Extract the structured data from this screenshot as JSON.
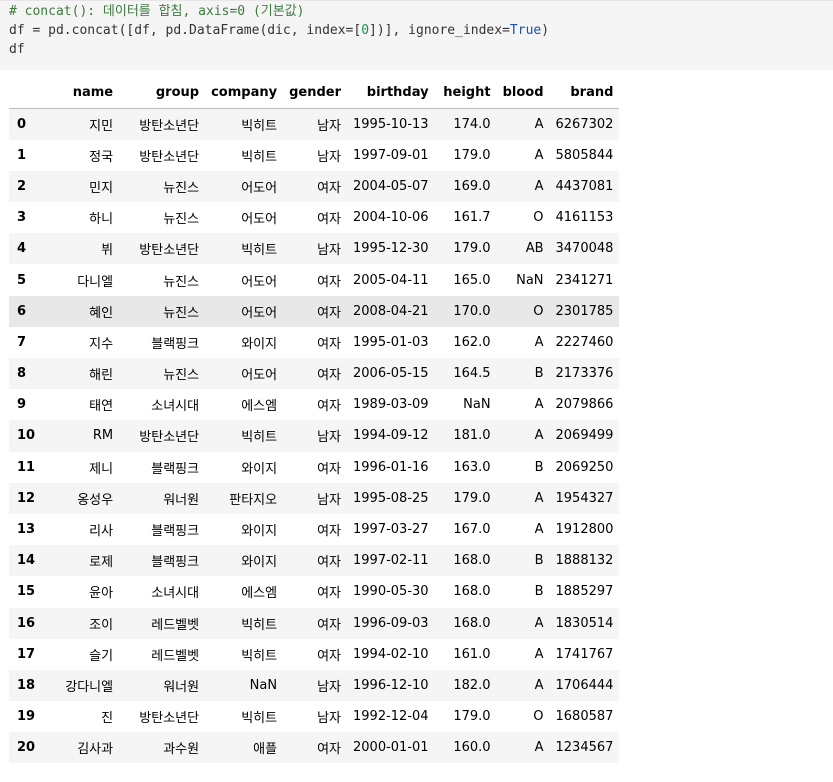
{
  "code": {
    "line1": "# concat(): 데이터를 합침, axis=0 (기본값)",
    "line2_a": "df = pd.concat([df, pd.DataFrame(dic, index=[",
    "line2_b": "0",
    "line2_c": "])], ignore_index=",
    "line2_d": "True",
    "line2_e": ")",
    "line3": "df"
  },
  "table": {
    "columns": [
      "",
      "name",
      "group",
      "company",
      "gender",
      "birthday",
      "height",
      "blood",
      "brand"
    ],
    "rows": [
      {
        "idx": "0",
        "name": "지민",
        "group": "방탄소년단",
        "company": "빅히트",
        "gender": "남자",
        "birthday": "1995-10-13",
        "height": "174.0",
        "blood": "A",
        "brand": "6267302"
      },
      {
        "idx": "1",
        "name": "정국",
        "group": "방탄소년단",
        "company": "빅히트",
        "gender": "남자",
        "birthday": "1997-09-01",
        "height": "179.0",
        "blood": "A",
        "brand": "5805844"
      },
      {
        "idx": "2",
        "name": "민지",
        "group": "뉴진스",
        "company": "어도어",
        "gender": "여자",
        "birthday": "2004-05-07",
        "height": "169.0",
        "blood": "A",
        "brand": "4437081"
      },
      {
        "idx": "3",
        "name": "하니",
        "group": "뉴진스",
        "company": "어도어",
        "gender": "여자",
        "birthday": "2004-10-06",
        "height": "161.7",
        "blood": "O",
        "brand": "4161153"
      },
      {
        "idx": "4",
        "name": "뷔",
        "group": "방탄소년단",
        "company": "빅히트",
        "gender": "남자",
        "birthday": "1995-12-30",
        "height": "179.0",
        "blood": "AB",
        "brand": "3470048"
      },
      {
        "idx": "5",
        "name": "다니엘",
        "group": "뉴진스",
        "company": "어도어",
        "gender": "여자",
        "birthday": "2005-04-11",
        "height": "165.0",
        "blood": "NaN",
        "brand": "2341271"
      },
      {
        "idx": "6",
        "name": "혜인",
        "group": "뉴진스",
        "company": "어도어",
        "gender": "여자",
        "birthday": "2008-04-21",
        "height": "170.0",
        "blood": "O",
        "brand": "2301785"
      },
      {
        "idx": "7",
        "name": "지수",
        "group": "블랙핑크",
        "company": "와이지",
        "gender": "여자",
        "birthday": "1995-01-03",
        "height": "162.0",
        "blood": "A",
        "brand": "2227460"
      },
      {
        "idx": "8",
        "name": "해린",
        "group": "뉴진스",
        "company": "어도어",
        "gender": "여자",
        "birthday": "2006-05-15",
        "height": "164.5",
        "blood": "B",
        "brand": "2173376"
      },
      {
        "idx": "9",
        "name": "태연",
        "group": "소녀시대",
        "company": "에스엠",
        "gender": "여자",
        "birthday": "1989-03-09",
        "height": "NaN",
        "blood": "A",
        "brand": "2079866"
      },
      {
        "idx": "10",
        "name": "RM",
        "group": "방탄소년단",
        "company": "빅히트",
        "gender": "남자",
        "birthday": "1994-09-12",
        "height": "181.0",
        "blood": "A",
        "brand": "2069499"
      },
      {
        "idx": "11",
        "name": "제니",
        "group": "블랙핑크",
        "company": "와이지",
        "gender": "여자",
        "birthday": "1996-01-16",
        "height": "163.0",
        "blood": "B",
        "brand": "2069250"
      },
      {
        "idx": "12",
        "name": "옹성우",
        "group": "워너원",
        "company": "판타지오",
        "gender": "남자",
        "birthday": "1995-08-25",
        "height": "179.0",
        "blood": "A",
        "brand": "1954327"
      },
      {
        "idx": "13",
        "name": "리사",
        "group": "블랙핑크",
        "company": "와이지",
        "gender": "여자",
        "birthday": "1997-03-27",
        "height": "167.0",
        "blood": "A",
        "brand": "1912800"
      },
      {
        "idx": "14",
        "name": "로제",
        "group": "블랙핑크",
        "company": "와이지",
        "gender": "여자",
        "birthday": "1997-02-11",
        "height": "168.0",
        "blood": "B",
        "brand": "1888132"
      },
      {
        "idx": "15",
        "name": "윤아",
        "group": "소녀시대",
        "company": "에스엠",
        "gender": "여자",
        "birthday": "1990-05-30",
        "height": "168.0",
        "blood": "B",
        "brand": "1885297"
      },
      {
        "idx": "16",
        "name": "조이",
        "group": "레드벨벳",
        "company": "빅히트",
        "gender": "여자",
        "birthday": "1996-09-03",
        "height": "168.0",
        "blood": "A",
        "brand": "1830514"
      },
      {
        "idx": "17",
        "name": "슬기",
        "group": "레드벨벳",
        "company": "빅히트",
        "gender": "여자",
        "birthday": "1994-02-10",
        "height": "161.0",
        "blood": "A",
        "brand": "1741767"
      },
      {
        "idx": "18",
        "name": "강다니엘",
        "group": "워너원",
        "company": "NaN",
        "gender": "남자",
        "birthday": "1996-12-10",
        "height": "182.0",
        "blood": "A",
        "brand": "1706444"
      },
      {
        "idx": "19",
        "name": "진",
        "group": "방탄소년단",
        "company": "빅히트",
        "gender": "남자",
        "birthday": "1992-12-04",
        "height": "179.0",
        "blood": "O",
        "brand": "1680587"
      },
      {
        "idx": "20",
        "name": "김사과",
        "group": "과수원",
        "company": "애플",
        "gender": "여자",
        "birthday": "2000-01-01",
        "height": "160.0",
        "blood": "A",
        "brand": "1234567"
      }
    ]
  }
}
